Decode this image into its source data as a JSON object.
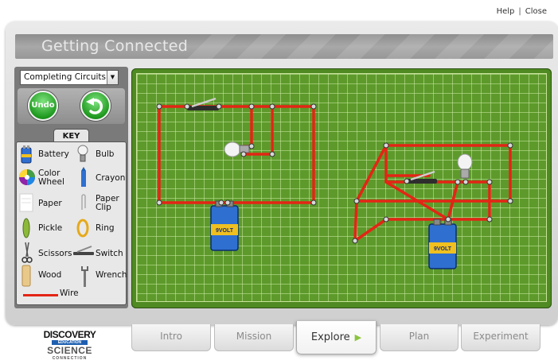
{
  "toplinks": {
    "help": "Help",
    "separator": "|",
    "close": "Close"
  },
  "title": "Getting Connected",
  "activity_select": {
    "value": "Completing Circuits"
  },
  "buttons": {
    "undo": "Undo",
    "reset_icon": "reset-arrow-icon"
  },
  "key": {
    "title": "KEY",
    "items": [
      {
        "label": "Battery",
        "icon": "battery-icon"
      },
      {
        "label": "Bulb",
        "icon": "bulb-icon"
      },
      {
        "label": "Color Wheel",
        "icon": "color-wheel-icon"
      },
      {
        "label": "Crayon",
        "icon": "crayon-icon"
      },
      {
        "label": "Paper",
        "icon": "paper-icon"
      },
      {
        "label": "Paper Clip",
        "icon": "paper-clip-icon"
      },
      {
        "label": "Pickle",
        "icon": "pickle-icon"
      },
      {
        "label": "Ring",
        "icon": "ring-icon"
      },
      {
        "label": "Scissors",
        "icon": "scissors-icon"
      },
      {
        "label": "Switch",
        "icon": "switch-icon"
      },
      {
        "label": "Wood",
        "icon": "wood-icon"
      },
      {
        "label": "Wrench",
        "icon": "wrench-icon"
      }
    ],
    "wire": {
      "label": "Wire",
      "icon": "wire-icon"
    }
  },
  "board": {
    "battery_label": "9VOLT",
    "colors": {
      "wire": "#e32515",
      "grid": "#5d9a2b",
      "board": "#4f8a22"
    }
  },
  "tabs": [
    {
      "label": "Intro",
      "active": false
    },
    {
      "label": "Mission",
      "active": false
    },
    {
      "label": "Explore",
      "active": true
    },
    {
      "label": "Plan",
      "active": false
    },
    {
      "label": "Experiment",
      "active": false
    }
  ],
  "logo": {
    "line1": "DISCOVERY",
    "line2": "EDUCATION",
    "line3": "SCIENCE",
    "line4": "CONNECTION"
  }
}
